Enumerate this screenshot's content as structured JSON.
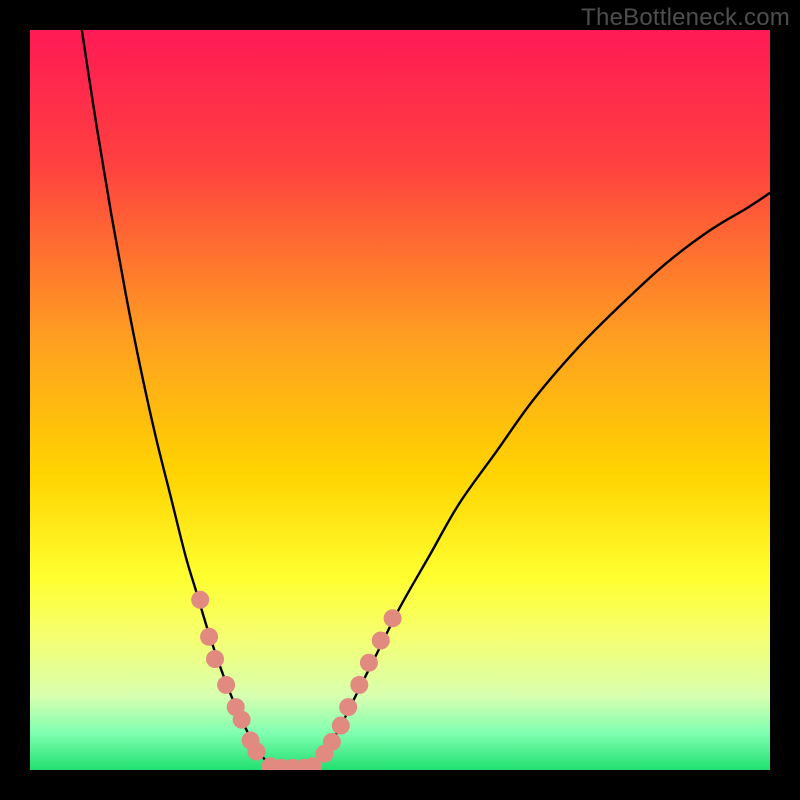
{
  "watermark": "TheBottleneck.com",
  "chart_data": {
    "type": "line",
    "title": "",
    "xlabel": "",
    "ylabel": "",
    "xlim": [
      0,
      100
    ],
    "ylim": [
      0,
      100
    ],
    "background_gradient": {
      "stops": [
        {
          "offset": 0,
          "color": "#ff1a55"
        },
        {
          "offset": 18,
          "color": "#ff4040"
        },
        {
          "offset": 42,
          "color": "#ffa020"
        },
        {
          "offset": 60,
          "color": "#ffd400"
        },
        {
          "offset": 74,
          "color": "#ffff30"
        },
        {
          "offset": 82,
          "color": "#f5ff70"
        },
        {
          "offset": 90,
          "color": "#d8ffb0"
        },
        {
          "offset": 95,
          "color": "#80ffb0"
        },
        {
          "offset": 100,
          "color": "#20e070"
        }
      ]
    },
    "series": [
      {
        "name": "curve-left",
        "x": [
          7,
          9,
          11,
          13,
          15,
          17,
          19,
          21,
          22.5,
          24,
          25.5,
          27,
          28.5,
          30,
          31.5,
          33
        ],
        "y": [
          100,
          87,
          75,
          64,
          54,
          45,
          37,
          29,
          24,
          19,
          14.5,
          10.5,
          7,
          4,
          1.7,
          0
        ]
      },
      {
        "name": "curve-right",
        "x": [
          38,
          40,
          42,
          44,
          47,
          50,
          54,
          58,
          63,
          68,
          74,
          80,
          86,
          92,
          97,
          100
        ],
        "y": [
          0,
          2.5,
          6,
          10,
          16,
          22,
          29,
          36,
          43,
          50,
          57,
          63,
          68.5,
          73,
          76,
          78
        ]
      }
    ],
    "flat_segment": {
      "x": [
        33,
        38
      ],
      "y": 0
    },
    "marker_groups": [
      {
        "name": "left-branch-markers",
        "color": "#e08a80",
        "points": [
          {
            "x": 23.0,
            "y": 23
          },
          {
            "x": 24.2,
            "y": 18
          },
          {
            "x": 25.0,
            "y": 15
          },
          {
            "x": 26.5,
            "y": 11.5
          },
          {
            "x": 27.8,
            "y": 8.5
          },
          {
            "x": 28.6,
            "y": 6.8
          },
          {
            "x": 29.8,
            "y": 4
          },
          {
            "x": 30.6,
            "y": 2.5
          }
        ]
      },
      {
        "name": "right-branch-markers",
        "color": "#e08a80",
        "points": [
          {
            "x": 39.8,
            "y": 2.2
          },
          {
            "x": 40.8,
            "y": 3.8
          },
          {
            "x": 42.0,
            "y": 6.0
          },
          {
            "x": 43.0,
            "y": 8.5
          },
          {
            "x": 44.5,
            "y": 11.5
          },
          {
            "x": 45.8,
            "y": 14.5
          },
          {
            "x": 47.4,
            "y": 17.5
          },
          {
            "x": 49.0,
            "y": 20.5
          }
        ]
      },
      {
        "name": "bottom-markers",
        "color": "#e08a80",
        "points": [
          {
            "x": 32.5,
            "y": 0.5
          },
          {
            "x": 34.0,
            "y": 0.3
          },
          {
            "x": 35.5,
            "y": 0.3
          },
          {
            "x": 37.0,
            "y": 0.3
          },
          {
            "x": 38.2,
            "y": 0.5
          }
        ]
      }
    ]
  }
}
